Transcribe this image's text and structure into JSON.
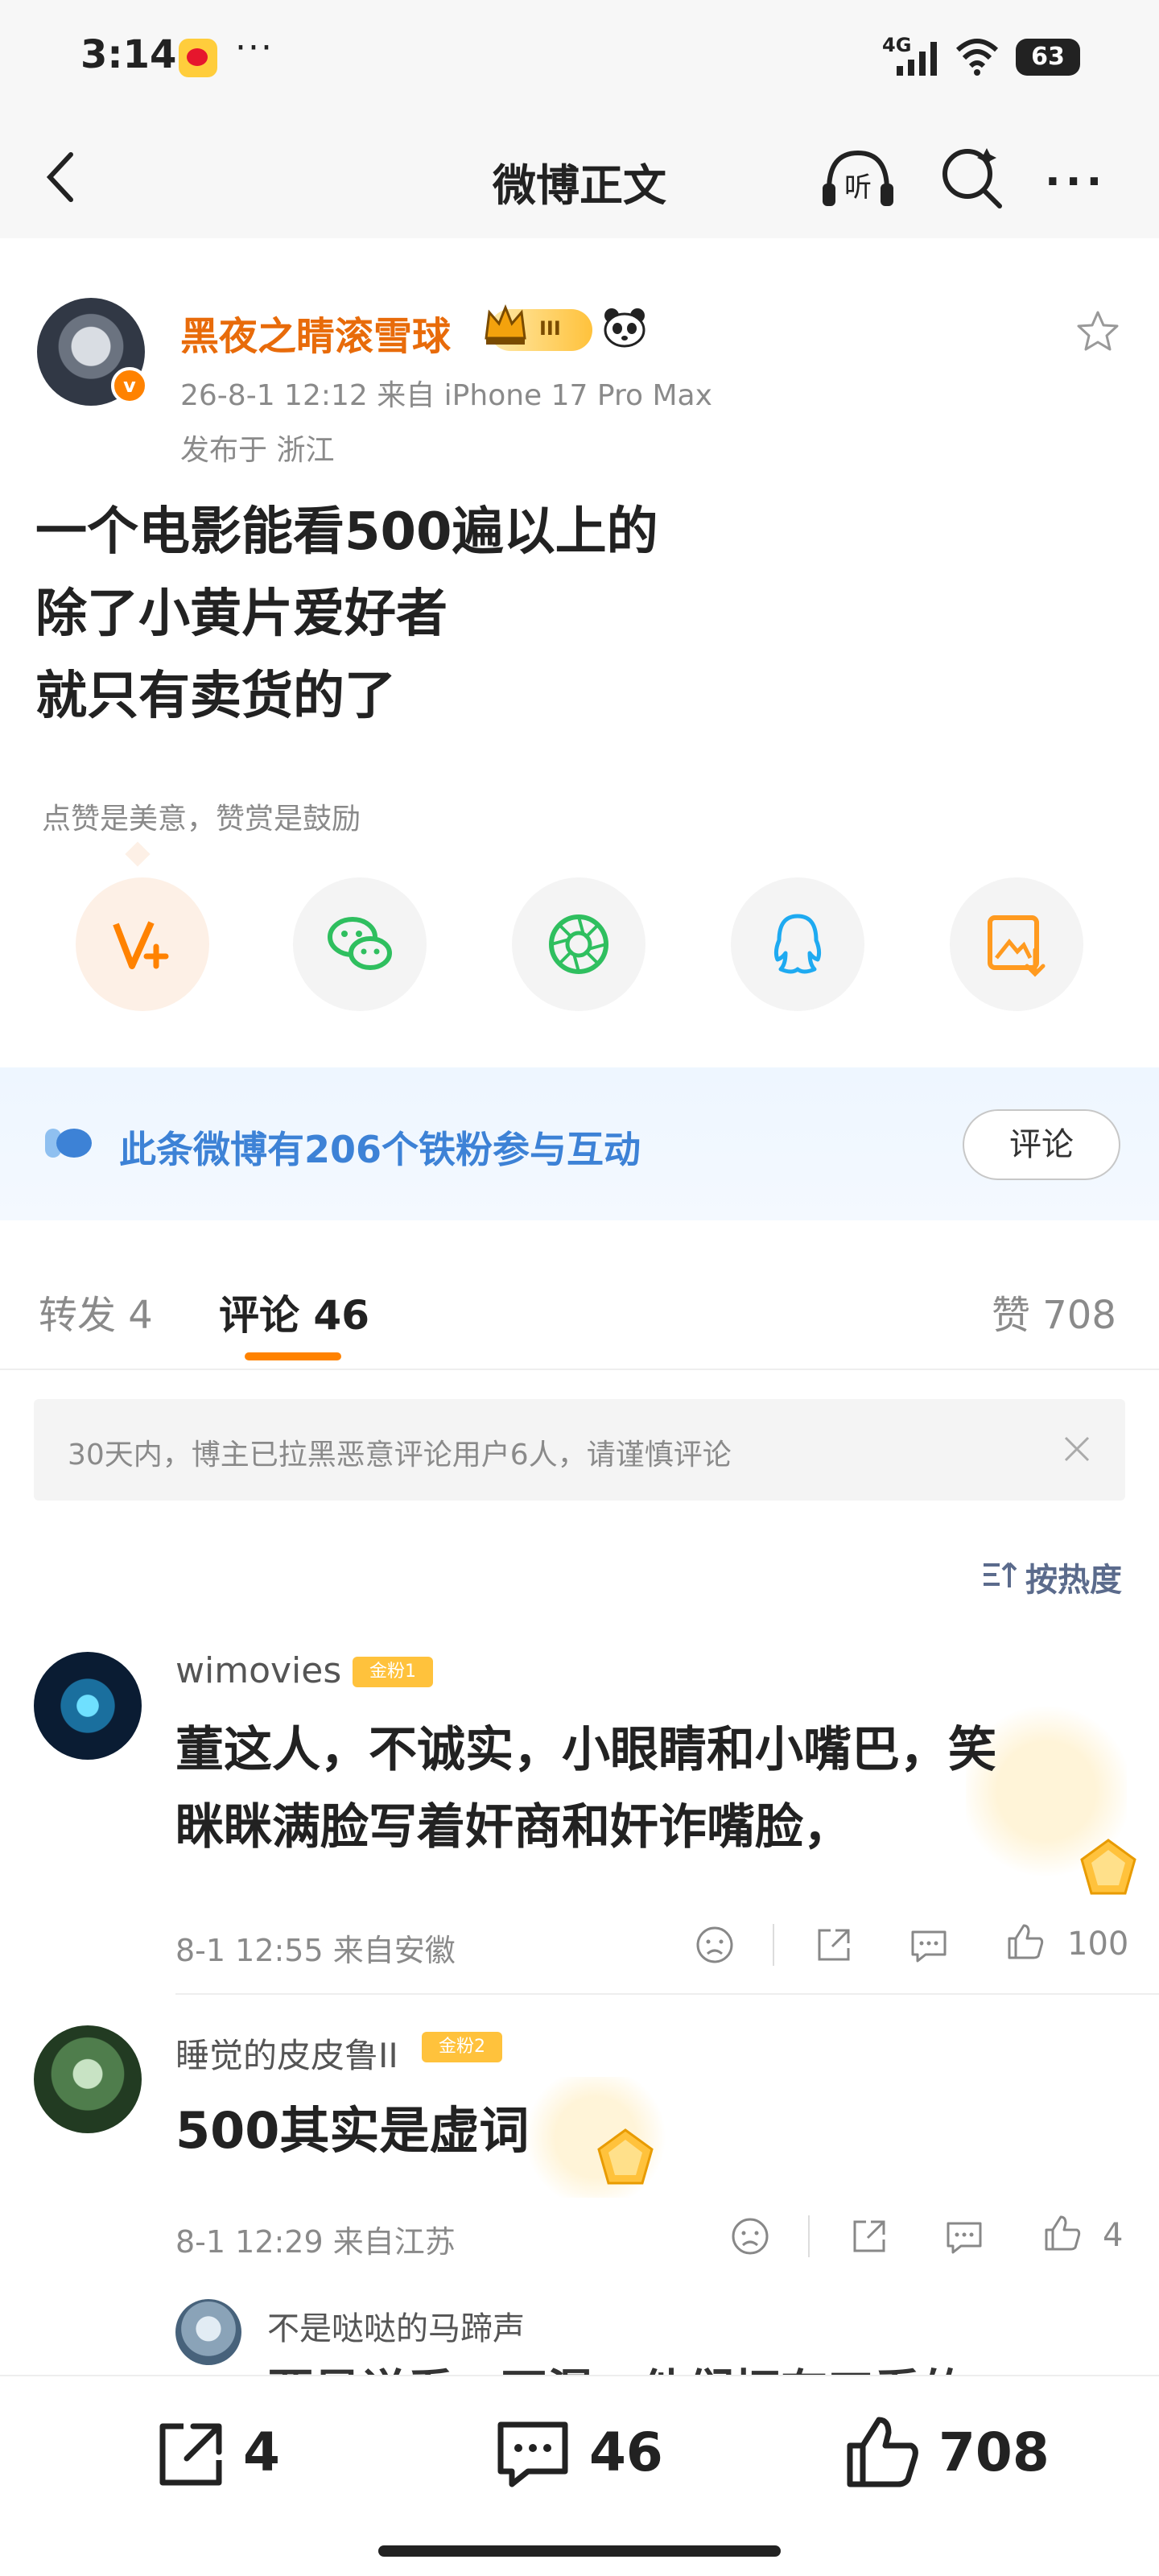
{
  "status_bar": {
    "time": "3:14",
    "more": "···",
    "network": "4G",
    "battery": "63"
  },
  "nav": {
    "title": "微博正文",
    "listen_label": "听"
  },
  "post": {
    "author": "黑夜之睛滚雪球",
    "member_level": "III",
    "verified_mark": "v",
    "meta": "26-8-1 12:12   来自 iPhone 17 Pro Max",
    "location": "发布于 浙江",
    "lines": [
      "一个电影能看500遍以上的",
      "除了小黄片爱好者",
      "就只有卖货的了"
    ],
    "tip": "点赞是美意，赞赏是鼓励"
  },
  "share": {
    "icons": [
      "vplus-icon",
      "wechat-icon",
      "moments-icon",
      "qq-icon",
      "save-image-icon"
    ]
  },
  "fans_banner": {
    "text": "此条微博有206个铁粉参与互动",
    "button": "评论"
  },
  "tabs": {
    "repost": "转发 4",
    "comments": "评论 46",
    "likes": "赞 708"
  },
  "notice": {
    "text": "30天内，博主已拉黑恶意评论用户6人，请谨慎评论"
  },
  "sort": {
    "label": "按热度"
  },
  "comments": [
    {
      "user": "wimovies",
      "badge": "金粉1",
      "lines": [
        "董这人，不诚实，小眼睛和小嘴巴，笑",
        "眯眯满脸写着奸商和奸诈嘴脸，"
      ],
      "meta": "8-1 12:55  来自安徽",
      "likes": "100"
    },
    {
      "user": "睡觉的皮皮鲁II",
      "badge": "金粉2",
      "text": "500其实是虚词",
      "meta": "8-1 12:29  来自江苏",
      "likes": "4"
    }
  ],
  "reply": {
    "user": "不是哒哒的马蹄声",
    "partial_text": "要是说看，不瀑，他们拥有工看的"
  },
  "bottom_bar": {
    "share_count": "4",
    "comment_count": "46",
    "like_count": "708"
  },
  "colors": {
    "accent": "#ff8200",
    "author_name": "#e86b0a",
    "fans_blue": "#3d82d6"
  }
}
